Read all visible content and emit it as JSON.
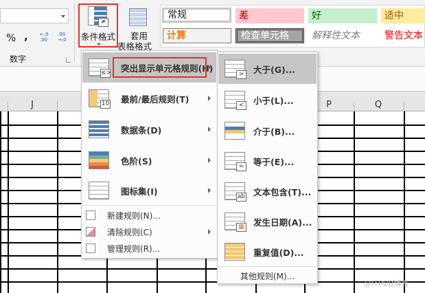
{
  "ribbon": {
    "number_group": {
      "percent": "%",
      "comma": ",",
      "inc_decimal": "←.0 .00",
      "dec_decimal": ".00 →.0",
      "label": "数字"
    },
    "conditional_format": "条件格式",
    "format_table_line1": "套用",
    "format_table_line2": "表格格式",
    "styles": [
      {
        "label": "常规",
        "bg": "#ffffff",
        "color": "#222222"
      },
      {
        "label": "差",
        "bg": "#ffc7ce",
        "color": "#9c0006"
      },
      {
        "label": "好",
        "bg": "#c6efce",
        "color": "#006100"
      },
      {
        "label": "适中",
        "bg": "#ffeb9c",
        "color": "#9c5700"
      },
      {
        "label": "计算",
        "bg": "#f2f2f2",
        "color": "#fa7d00"
      },
      {
        "label": "检查单元格",
        "bg": "#a5a5a5",
        "color": "#ffffff"
      },
      {
        "label": "解释性文本",
        "bg": "#f3f3f3",
        "color": "#7f7f7f"
      },
      {
        "label": "警告文本",
        "bg": "#f3f3f3",
        "color": "#ff0000"
      }
    ]
  },
  "columns": [
    "J",
    "P",
    "Q"
  ],
  "menu": {
    "items": [
      {
        "label": "突出显示单元格规则(H)",
        "icon": "highlight-cells-icon"
      },
      {
        "label": "最前/最后规则(T)",
        "icon": "top-bottom-icon"
      },
      {
        "label": "数据条(D)",
        "icon": "data-bars-icon"
      },
      {
        "label": "色阶(S)",
        "icon": "color-scales-icon"
      },
      {
        "label": "图标集(I)",
        "icon": "icon-sets-icon"
      }
    ],
    "small_items": [
      {
        "label": "新建规则(N)..."
      },
      {
        "label": "清除规则(C)"
      },
      {
        "label": "管理规则(R)..."
      }
    ]
  },
  "submenu": {
    "items": [
      {
        "label": "大于(G)...",
        "badge": ">"
      },
      {
        "label": "小于(L)...",
        "badge": "<"
      },
      {
        "label": "介于(B)...",
        "badge": ""
      },
      {
        "label": "等于(E)...",
        "badge": "="
      },
      {
        "label": "文本包含(T)...",
        "badge": "ab"
      },
      {
        "label": "发生日期(A)...",
        "badge": "▦"
      },
      {
        "label": "重复值(D)...",
        "badge": ""
      }
    ],
    "more": "其他规则(M)..."
  },
  "watermark": "@ITPUB博客"
}
